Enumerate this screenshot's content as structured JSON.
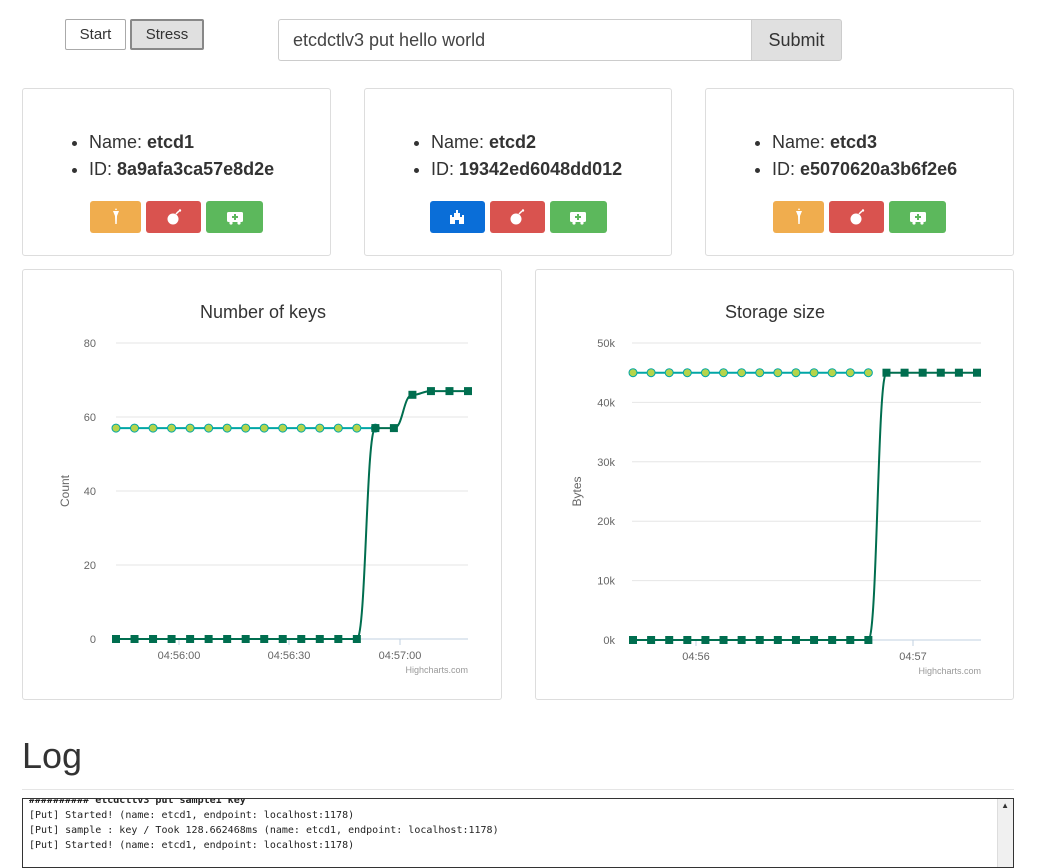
{
  "toolbar": {
    "start_label": "Start",
    "stress_label": "Stress"
  },
  "command": {
    "value": "etcdctlv3 put hello world",
    "submit_label": "Submit"
  },
  "nodes": [
    {
      "name_label": "Name: ",
      "name": "etcd1",
      "id_label": "ID: ",
      "id": "8a9afa3ca57e8d2e",
      "buttons": [
        "torch-icon",
        "bomb-icon",
        "ambulance-icon"
      ],
      "first_color": "#f0ad4e"
    },
    {
      "name_label": "Name: ",
      "name": "etcd2",
      "id_label": "ID: ",
      "id": "19342ed6048dd012",
      "buttons": [
        "castle-icon",
        "bomb-icon",
        "ambulance-icon"
      ],
      "first_color": "#0a6ed8"
    },
    {
      "name_label": "Name: ",
      "name": "etcd3",
      "id_label": "ID: ",
      "id": "e5070620a3b6f2e6",
      "buttons": [
        "torch-icon",
        "bomb-icon",
        "ambulance-icon"
      ],
      "first_color": "#f0ad4e"
    }
  ],
  "chart_data": [
    {
      "type": "line",
      "title": "Number of keys",
      "ylabel": "Count",
      "ylim": [
        0,
        80
      ],
      "yticks": [
        "0",
        "20",
        "40",
        "60",
        "80"
      ],
      "xtick_labels": [
        "04:56:00",
        "04:56:30",
        "04:57:00"
      ],
      "credit": "Highcharts.com",
      "series": [
        {
          "color": "#00a6a6",
          "marker": "circle",
          "marker_color": "#b6d44a",
          "values": [
            57,
            57,
            57,
            57,
            57,
            57,
            57,
            57,
            57,
            57,
            57,
            57,
            57,
            57,
            57,
            null,
            null,
            null,
            null,
            null
          ]
        },
        {
          "color": "#006e4f",
          "marker": "square",
          "values": [
            0,
            0,
            0,
            0,
            0,
            0,
            0,
            0,
            0,
            0,
            0,
            0,
            0,
            0,
            57,
            57,
            66,
            67,
            67,
            67
          ]
        }
      ]
    },
    {
      "type": "line",
      "title": "Storage size",
      "ylabel": "Bytes",
      "ylim": [
        0,
        50000
      ],
      "yticks": [
        "0k",
        "10k",
        "20k",
        "30k",
        "40k",
        "50k"
      ],
      "xtick_labels": [
        "04:56",
        "04:57"
      ],
      "credit": "Highcharts.com",
      "series": [
        {
          "color": "#00a6a6",
          "marker": "circle",
          "marker_color": "#b6d44a",
          "values": [
            45000,
            45000,
            45000,
            45000,
            45000,
            45000,
            45000,
            45000,
            45000,
            45000,
            45000,
            45000,
            45000,
            45000,
            null,
            null,
            null,
            null,
            null,
            null
          ]
        },
        {
          "color": "#006e4f",
          "marker": "square",
          "values": [
            0,
            0,
            0,
            0,
            0,
            0,
            0,
            0,
            0,
            0,
            0,
            0,
            0,
            0,
            45000,
            45000,
            45000,
            45000,
            45000,
            45000
          ]
        }
      ]
    }
  ],
  "log": {
    "heading": "Log",
    "lines": [
      "########## etcdctlv3 put sample1 key",
      "[Put] Started! (name: etcd1, endpoint: localhost:1178)",
      "[Put] sample : key / Took 128.662468ms (name: etcd1, endpoint: localhost:1178)",
      "[Put] Started! (name: etcd1, endpoint: localhost:1178)"
    ]
  }
}
